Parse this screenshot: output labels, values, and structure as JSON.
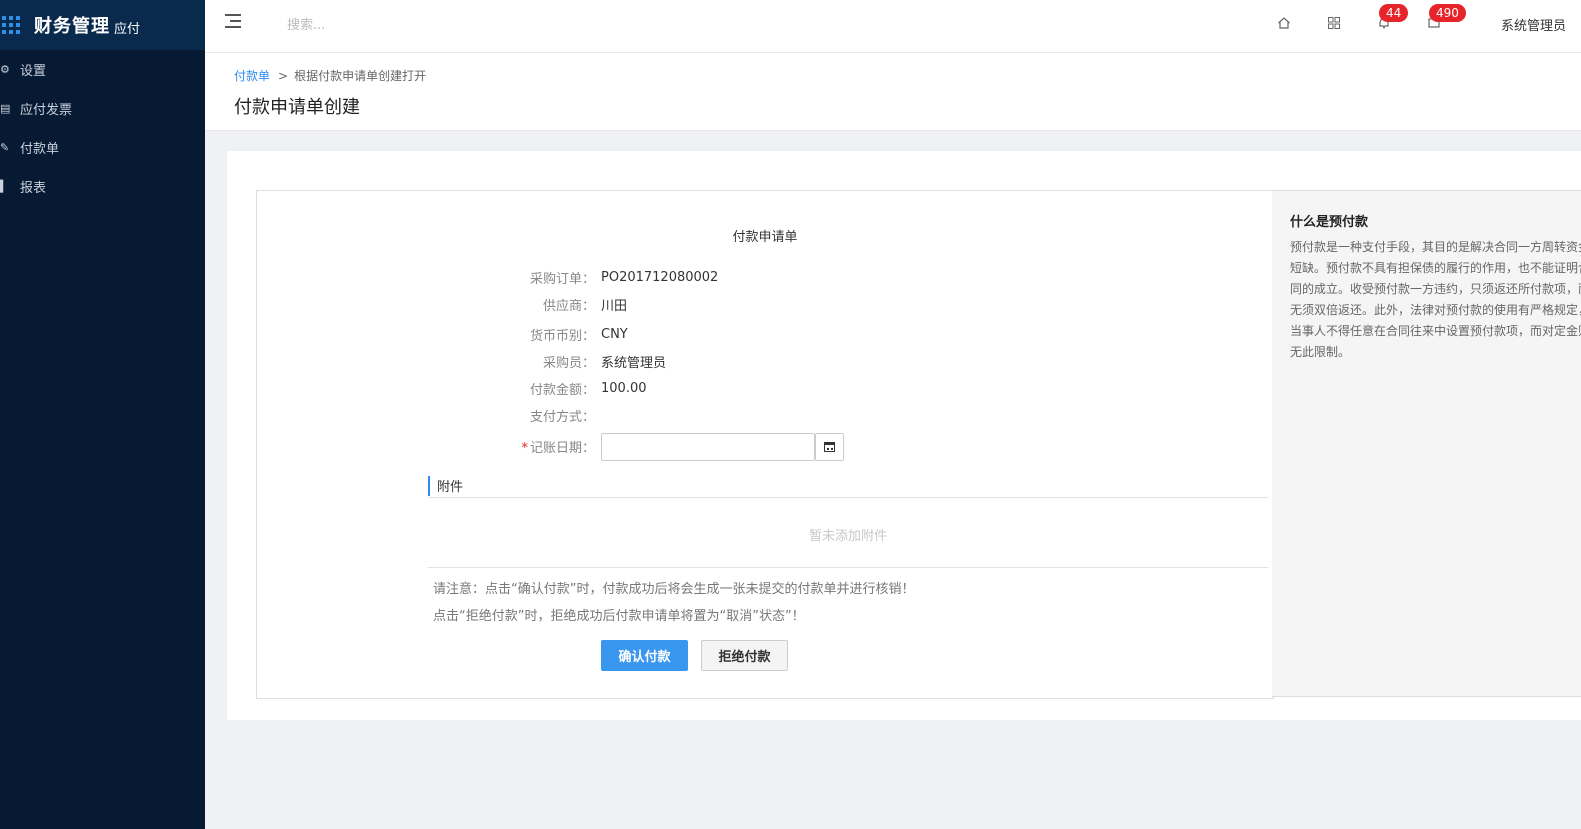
{
  "app": {
    "title": "财务管理",
    "module": "应付"
  },
  "sidebar": {
    "items": [
      {
        "label": "设置",
        "icon": "gear-icon"
      },
      {
        "label": "应付发票",
        "icon": "invoice-icon"
      },
      {
        "label": "付款单",
        "icon": "payment-doc-icon"
      },
      {
        "label": "报表",
        "icon": "bar-chart-icon"
      }
    ]
  },
  "header": {
    "search_placeholder": "搜索...",
    "notifications_count": "44",
    "messages_count": "490",
    "user_name": "系统管理员"
  },
  "breadcrumb": {
    "parent": "付款单",
    "separator": ">",
    "current": "根据付款申请单创建打开"
  },
  "page": {
    "title": "付款申请单创建"
  },
  "form": {
    "title": "付款申请单",
    "fields": [
      {
        "label": "采购订单：",
        "value": "PO201712080002"
      },
      {
        "label": "供应商：",
        "value": "川田"
      },
      {
        "label": "货币币别：",
        "value": "CNY"
      },
      {
        "label": "采购员：",
        "value": "系统管理员"
      },
      {
        "label": "付款金额：",
        "value": "100.00"
      },
      {
        "label": "支付方式：",
        "value": ""
      }
    ],
    "date_label": "记账日期：",
    "date_required_mark": "*",
    "date_value": "",
    "attachments_title": "附件",
    "attachments_empty": "暂未添加附件",
    "note_line1": "请注意：点击“确认付款”时，付款成功后将会生成一张未提交的付款单并进行核销！",
    "note_line2": "点击“拒绝付款”时，拒绝成功后付款申请单将置为“取消”状态”！",
    "confirm_label": "确认付款",
    "reject_label": "拒绝付款"
  },
  "help": {
    "title": "什么是预付款",
    "text": "预付款是一种支付手段，其目的是解决合同一方周转资金短缺。预付款不具有担保债的履行的作用，也不能证明合同的成立。收受预付款一方违约，只须返还所付款项，而无须双倍返还。此外，法律对预付款的使用有严格规定，当事人不得任意在合同往来中设置预付款项，而对定金则无此限制。"
  },
  "colors": {
    "sidebar_bg": "#071a33",
    "brand_bg": "#0a2a4d",
    "accent": "#3a97f0",
    "badge": "#e8242b"
  }
}
